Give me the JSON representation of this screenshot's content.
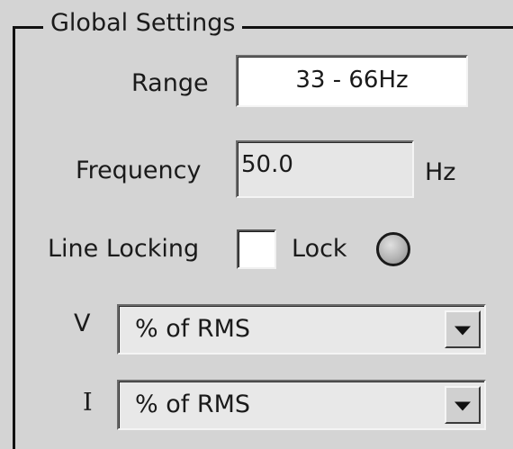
{
  "group": {
    "title": "Global Settings"
  },
  "range": {
    "label": "Range",
    "value": "33 - 66Hz"
  },
  "frequency": {
    "label": "Frequency",
    "value": "50.0",
    "unit": "Hz"
  },
  "line_locking": {
    "label": "Line Locking",
    "checked": false,
    "lock_label": "Lock",
    "lock_icon": "lock-indicator-led"
  },
  "v_select": {
    "label": "V",
    "selected": "% of RMS",
    "icon": "chevron-down-icon"
  },
  "i_select": {
    "label": "I",
    "selected": "% of RMS",
    "icon": "chevron-down-icon"
  }
}
